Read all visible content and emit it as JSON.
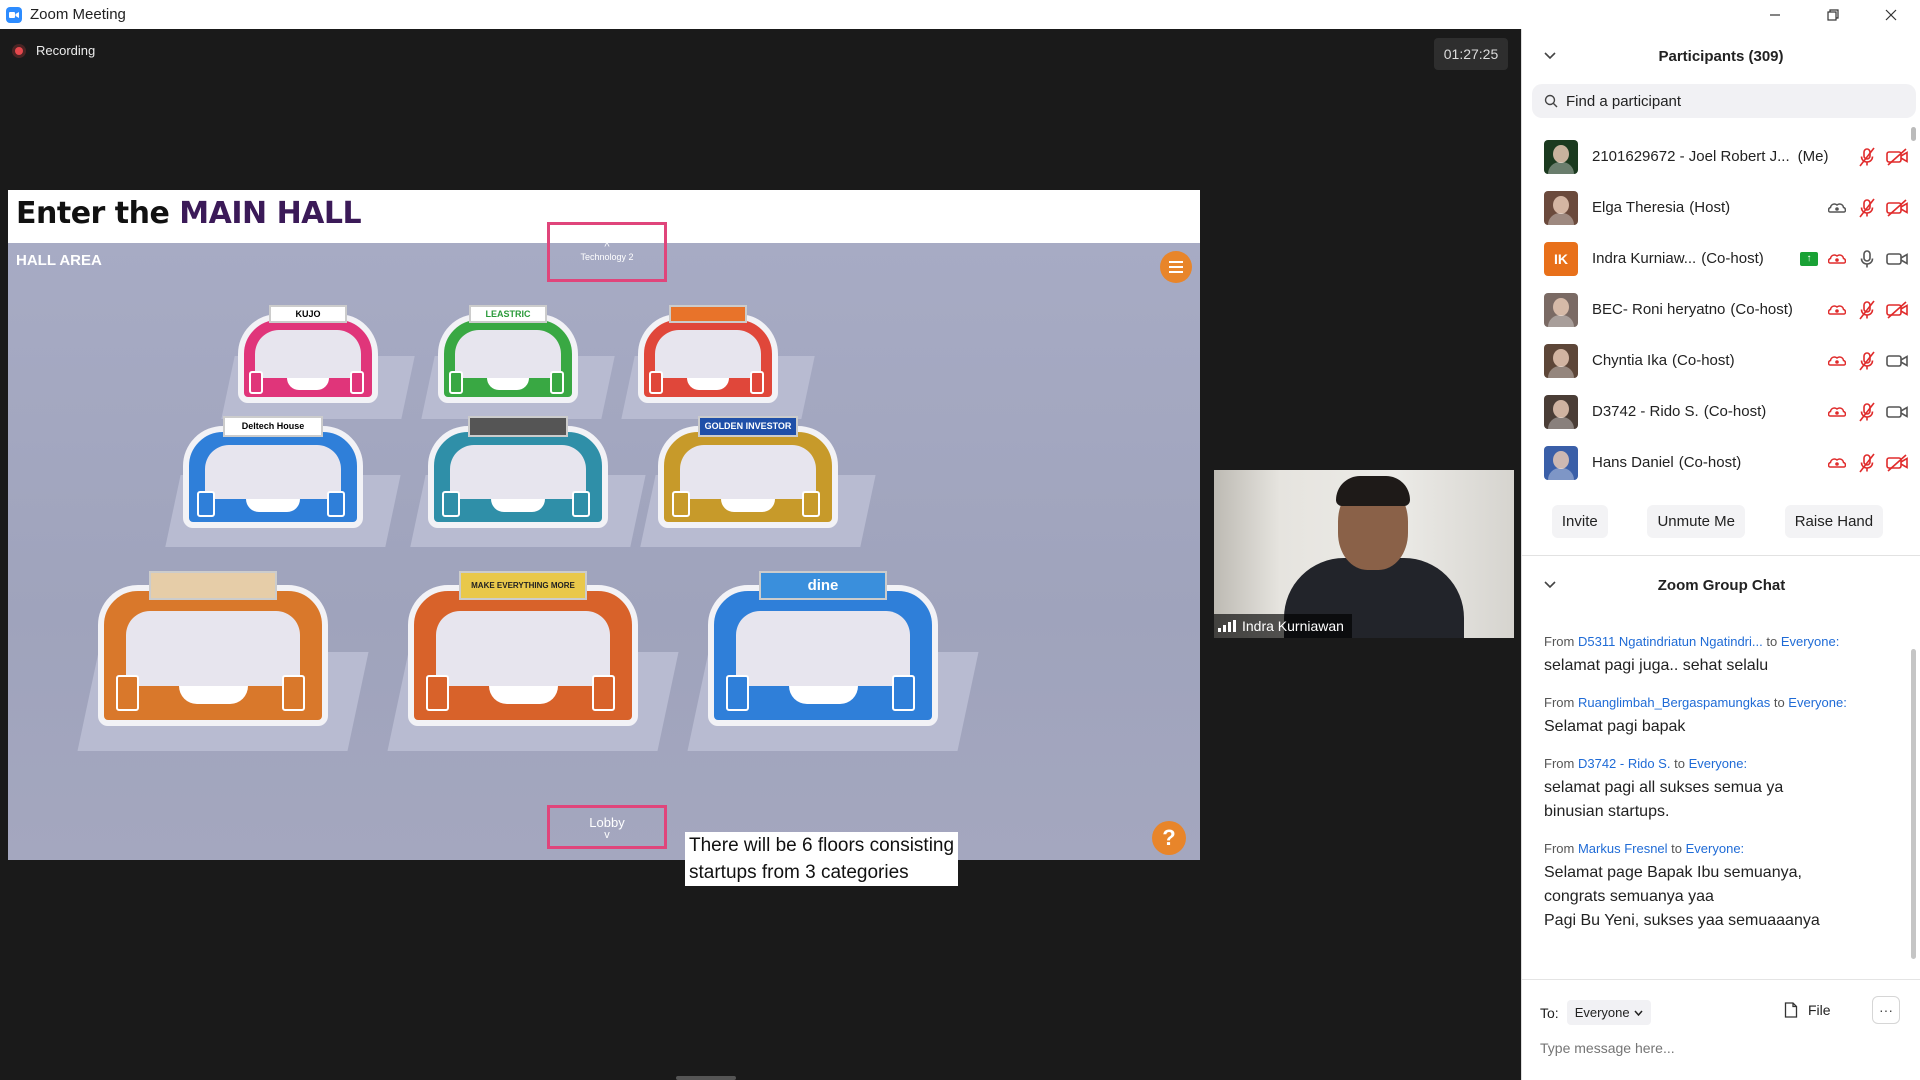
{
  "window": {
    "title": "Zoom Meeting",
    "controls": [
      "minimize",
      "restore",
      "close"
    ]
  },
  "meeting": {
    "recording_label": "Recording",
    "timer": "01:27:25"
  },
  "slide": {
    "title_prefix": "Enter the ",
    "title_accent": "MAIN HALL",
    "hall_label": "HALL AREA",
    "nav_top_label": "Technology 2",
    "nav_bottom_label": "Lobby",
    "caption_line1": "There will be 6 floors consisting",
    "caption_line2": "startups from 3 categories",
    "help": "?",
    "booths": [
      {
        "sign": "KUJO",
        "color": "#e0357a"
      },
      {
        "sign": "LEASTRIC",
        "color": "#39a843"
      },
      {
        "sign": "",
        "color": "#e0473a"
      },
      {
        "sign": "Deltech House",
        "color": "#2f7fd9"
      },
      {
        "sign": "",
        "color": "#2f8fa8"
      },
      {
        "sign": "GOLDEN INVESTOR",
        "color": "#c79a2a"
      },
      {
        "sign": "",
        "color": "#d9782b"
      },
      {
        "sign": "MAKE EVERYTHING MORE",
        "color": "#d8622a"
      },
      {
        "sign": "dine",
        "color": "#2f7fd9"
      }
    ]
  },
  "self_video": {
    "name": "Indra Kurniawan"
  },
  "participants": {
    "header": "Participants (309)",
    "search_placeholder": "Find a participant",
    "list": [
      {
        "name": "2101629672 - Joel Robert J...",
        "role": "(Me)",
        "avatar_color": "#1b3a1f"
      },
      {
        "name": "Elga Theresia",
        "role": "(Host)",
        "avatar_color": "#6b4a3c"
      },
      {
        "name": "Indra Kurniaw...",
        "role": "(Co-host)",
        "avatar_initials": "IK",
        "avatar_color": "#e8701a"
      },
      {
        "name": "BEC- Roni heryatno",
        "role": "(Co-host)",
        "avatar_color": "#7a6a64"
      },
      {
        "name": "Chyntia Ika",
        "role": "(Co-host)",
        "avatar_color": "#5d4638"
      },
      {
        "name": "D3742 - Rido S.",
        "role": "(Co-host)",
        "avatar_color": "#4a3d36"
      },
      {
        "name": "Hans Daniel",
        "role": "(Co-host)",
        "avatar_color": "#3a5fa8"
      }
    ],
    "buttons": {
      "invite": "Invite",
      "unmute": "Unmute Me",
      "raise_hand": "Raise Hand"
    }
  },
  "chat": {
    "header": "Zoom Group Chat",
    "from_label": "From",
    "to_label": "to",
    "messages": [
      {
        "sender": "D5311 Ngatindriatun Ngatindri...",
        "recipient": "Everyone:",
        "lines": [
          "selamat pagi juga.. sehat selalu"
        ]
      },
      {
        "sender": "Ruanglimbah_Bergaspamungkas",
        "recipient": "Everyone:",
        "lines": [
          "Selamat pagi bapak"
        ]
      },
      {
        "sender": "D3742 - Rido S.",
        "recipient": "Everyone:",
        "lines": [
          "selamat pagi all sukses semua ya",
          "binusian startups."
        ]
      },
      {
        "sender": "Markus Fresnel",
        "recipient": "Everyone:",
        "lines": [
          "Selamat page Bapak Ibu semuanya,",
          "congrats semuanya yaa",
          "Pagi Bu Yeni, sukses yaa semuaaanya"
        ]
      }
    ],
    "to_prefix": "To:",
    "to_value": "Everyone",
    "file_label": "File",
    "more_label": "···",
    "input_placeholder": "Type message here..."
  },
  "colors": {
    "accent_blue": "#1f6bd6",
    "recording_red": "#e5484d",
    "mute_red": "#e02b2b",
    "highlight_pink": "#e0457b",
    "orange": "#e8852a",
    "slide_title_accent": "#3b1a58"
  }
}
